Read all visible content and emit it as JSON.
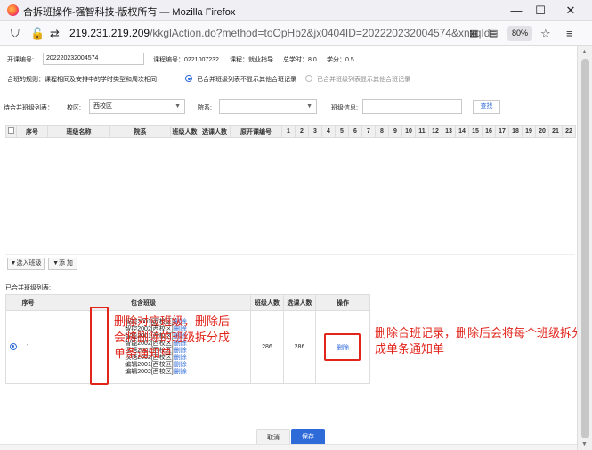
{
  "window": {
    "title": "合拆班操作-强智科技-版权所有 — Mozilla Firefox"
  },
  "browser": {
    "url_host": "219.231.219.209",
    "url_path": "/kkglAction.do?method=toOpHb2&jx0404ID=202220232004574&xnxqId=",
    "zoom": "80%"
  },
  "course_info": {
    "code_label": "开课编号:",
    "code_value": "202220232004574",
    "course_no": "课程编号：0221007232",
    "course_name": "课程：就业指导",
    "total_hours": "总学时：8.0",
    "credits": "学分：0.5"
  },
  "merge_rule": {
    "label": "合班的规则：课程相同及安排中的学时类型和周次相同",
    "option1": "已合并班级列表不显示其他合班记录",
    "option2": "已合并班级列表显示其他合班记录"
  },
  "filters": {
    "section_label": "待合并班级列表：",
    "campus_label": "校区:",
    "campus_value": "西校区",
    "dept_label": "院系:",
    "dept_value": "",
    "classinfo_label": "班级信息:",
    "classinfo_value": "",
    "search_btn": "查找"
  },
  "pending_table": {
    "headers": [
      "序号",
      "班级名称",
      "院系",
      "班级人数",
      "选课人数",
      "原开课编号",
      "1",
      "2",
      "3",
      "4",
      "5",
      "6",
      "7",
      "8",
      "9",
      "10",
      "11",
      "12",
      "13",
      "14",
      "15",
      "16",
      "17",
      "18",
      "19",
      "20",
      "21",
      "22"
    ]
  },
  "actions": {
    "select_class": "▼选入班级",
    "add": "▼添 加"
  },
  "merged_section": {
    "label": "已合并班级列表:",
    "headers": [
      "序号",
      "包含班级",
      "班级人数",
      "选课人数",
      "操作"
    ],
    "row": {
      "index": "1",
      "classes": [
        "智控2001[西校区]",
        "智控2002[西校区]",
        "智能2001[西校区]",
        "智能2002[西校区]",
        "汉语2001[西校区]",
        "汉语2002[西校区]",
        "编辑2001[西校区]",
        "编辑2002[西校区]"
      ],
      "class_action": "删除",
      "class_count": "286",
      "selected_count": "286",
      "op": "删除"
    }
  },
  "annotations": {
    "left": "删除对应班级，删除后会将删除的班级拆分成单条通知单",
    "right": "删除合班记录，删除后会将每个班级拆分成单条通知单"
  },
  "footer": {
    "cancel": "取消",
    "save": "保存"
  },
  "colors": {
    "accent": "#2f6bd8",
    "annotation": "#e1251b"
  }
}
